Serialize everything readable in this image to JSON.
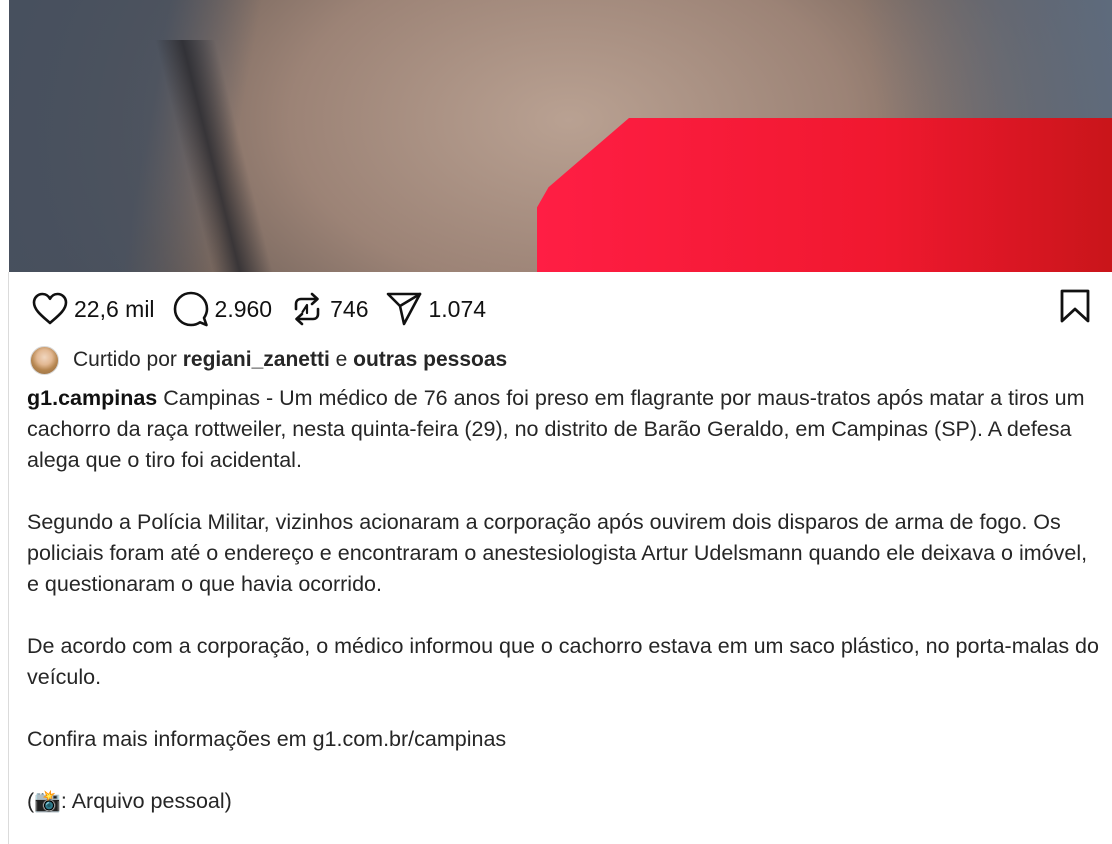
{
  "post": {
    "actions": {
      "likes": "22,6 mil",
      "comments": "2.960",
      "reposts": "746",
      "shares": "1.074"
    },
    "liked_by": {
      "prefix": "Curtido por",
      "user": "regiani_zanetti",
      "connector": "e",
      "others": "outras pessoas"
    },
    "caption": {
      "username": "g1.campinas",
      "paragraph_1": "Campinas - Um médico de 76 anos foi preso em flagrante por maus-tratos após matar a tiros um cachorro da raça rottweiler, nesta quinta-feira (29), no distrito de Barão Geraldo, em Campinas (SP). A defesa alega que o tiro foi acidental.",
      "paragraph_2": "Segundo a Polícia Militar, vizinhos acionaram a corporação após ouvirem dois disparos de arma de fogo. Os policiais foram até o endereço e encontraram o anestesiologista Artur Udelsmann quando ele deixava o imóvel, e questionaram o que havia ocorrido.",
      "paragraph_3": "De acordo com a corporação, o médico informou que o cachorro estava em um saco plástico, no porta-malas do veículo.",
      "paragraph_4": "Confira mais informações em g1.com.br/campinas",
      "paragraph_5": "(📸: Arquivo pessoal)"
    }
  },
  "icons": {
    "like": "heart-icon",
    "comment": "comment-bubble-icon",
    "repost": "repost-icon",
    "share": "send-icon",
    "save": "bookmark-icon"
  },
  "colors": {
    "accent_red": "#ff1e44",
    "text": "#262626"
  }
}
